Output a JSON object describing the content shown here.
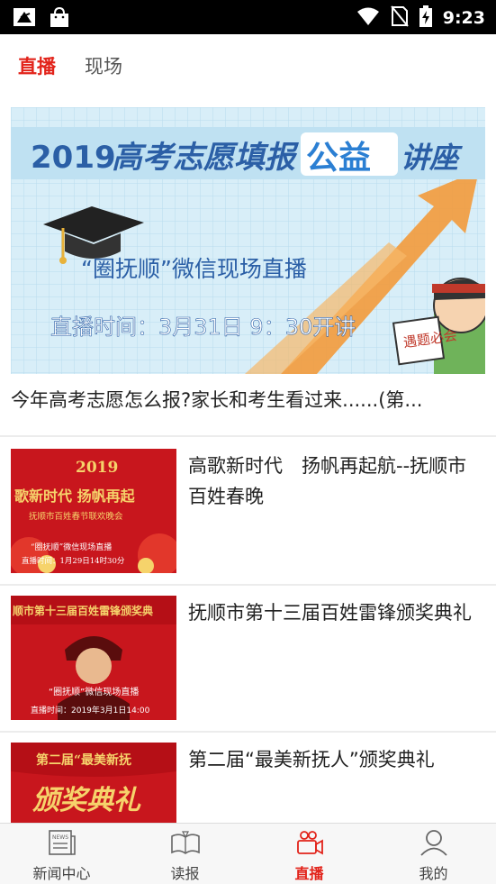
{
  "status_bar": {
    "time": "9:23"
  },
  "tabs": [
    {
      "label": "直播",
      "active": true
    },
    {
      "label": "现场",
      "active": false
    }
  ],
  "hero": {
    "banner_title_year": "2019",
    "banner_title_a": "高考志愿填报",
    "banner_title_b": "公益",
    "banner_title_c": "讲座",
    "banner_subtitle": "“圈抚顺”微信现场直播",
    "banner_time": "直播时间：3月31日 9：30开讲",
    "banner_sign": "遇题必会",
    "caption": "今年高考志愿怎么报?家长和考生看过来......(第..."
  },
  "news": [
    {
      "title": "高歌新时代　扬帆再起航--抚顺市百姓春晚",
      "thumb": {
        "year": "2019",
        "line1": "歌新时代 扬帆再起",
        "line2": "抚顺市百姓春节联欢晚会",
        "line3": "“圈抚顺”微信现场直播",
        "line4": "直播时间：1月29日14时30分"
      }
    },
    {
      "title": "抚顺市第十三届百姓雷锋颁奖典礼",
      "thumb": {
        "line1": "顺市第十三届百姓雷锋颁奖典",
        "line2": "“圈抚顺”微信现场直播",
        "line3": "直播时间：2019年3月1日14:00"
      }
    },
    {
      "title": "第二届“最美新抚人”颁奖典礼",
      "thumb": {
        "line1": "第二届“最美新抚",
        "line2": "颁奖典礼"
      }
    }
  ],
  "bottom_nav": [
    {
      "label": "新闻中心",
      "icon": "newspaper-icon",
      "active": false
    },
    {
      "label": "读报",
      "icon": "open-book-icon",
      "active": false
    },
    {
      "label": "直播",
      "icon": "video-camera-icon",
      "active": true
    },
    {
      "label": "我的",
      "icon": "person-icon",
      "active": false
    }
  ],
  "colors": {
    "accent": "#e2231a",
    "banner_bg": "#d8eef8",
    "thumb_red": "#c8161d",
    "thumb_gold": "#f6d36b"
  }
}
